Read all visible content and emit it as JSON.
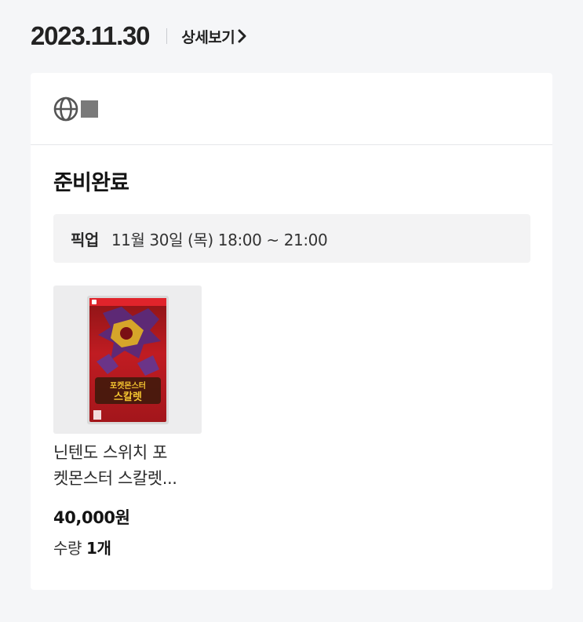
{
  "order": {
    "date": "2023.11.30",
    "detail_link_label": "상세보기"
  },
  "store": {
    "logo_icon": "globe-icon"
  },
  "status": {
    "title": "준비완료"
  },
  "pickup": {
    "label": "픽업",
    "time": "11월 30일 (목) 18:00 ~ 21:00"
  },
  "product": {
    "name_line1": "닌텐도 스위치 포",
    "name_line2": "켓몬스터 스칼렛...",
    "price": "40,000원",
    "quantity_label": "수량",
    "quantity_value": "1개",
    "thumbnail_icon": "game-box-cover-icon",
    "cover_text_line1": "포켓몬스터",
    "cover_text_line2": "스칼렛"
  },
  "colors": {
    "background": "#f5f6f8",
    "card": "#ffffff",
    "pickup_box": "#f3f3f4",
    "cover_red": "#c01c22"
  }
}
